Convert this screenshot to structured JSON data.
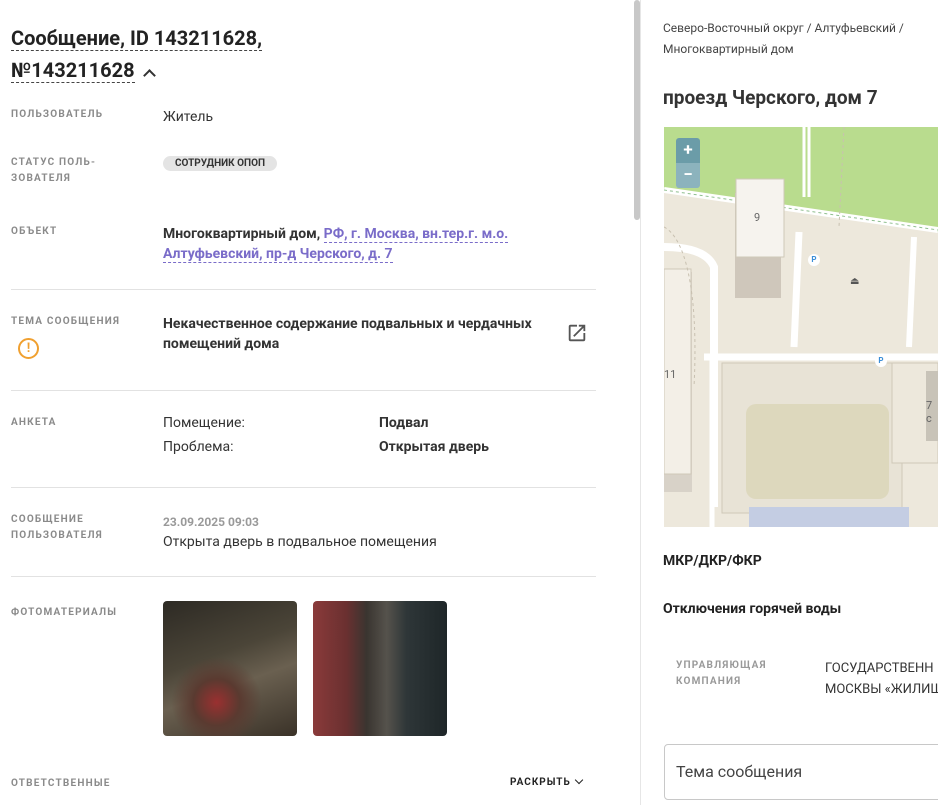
{
  "message": {
    "title_line1": "Сообщение, ID 143211628,",
    "title_line2": "№143211628"
  },
  "fields": {
    "user_label": "ПОЛЬЗОВАТЕЛЬ",
    "user_value": "Житель",
    "status_label_1": "СТАТУС ПОЛЬ-",
    "status_label_2": "ЗОВАТЕЛЯ",
    "status_badge": "СОТРУДНИК ОПОП",
    "object_label": "ОБЪЕКТ",
    "object_type": "Многоквартирный дом,",
    "object_addr_1": "РФ, г. Москва, вн.тер.г. м.о.",
    "object_addr_2": "Алтуфьевский, пр-д Черского, д. 7",
    "topic_label": "ТЕМА СООБЩЕНИЯ",
    "topic_1": "Некачественное содержание подвальных и чердачных",
    "topic_2": "помещений дома",
    "form_label": "АНКЕТА",
    "q1": "Помещение:",
    "a1": "Подвал",
    "q2": "Проблема:",
    "a2": "Открытая дверь",
    "msg_label_1": "СООБЩЕНИЕ",
    "msg_label_2": "ПОЛЬЗОВАТЕЛЯ",
    "msg_date": "23.09.2025 09:03",
    "msg_text": "Открыта дверь в подвальное помещения",
    "photos_label": "ФОТОМАТЕРИАЛЫ",
    "resp_label": "ОТВЕТСТВЕННЫЕ",
    "expand": "РАСКРЫТЬ"
  },
  "right": {
    "crumb_1": "Северо-Восточный округ / Алтуфьевский /",
    "crumb_2": "Многоквартирный дом",
    "address": "проезд Черского, дом 7",
    "map": {
      "zoom_in": "+",
      "zoom_out": "−",
      "house_9": "9",
      "house_11": "11",
      "house_7": "7 с",
      "parking": "P"
    },
    "sub1": "МКР/ДКР/ФКР",
    "sub2": "Отключения горячей воды",
    "mc_label_1": "УПРАВЛЯЮЩАЯ",
    "mc_label_2": "КОМПАНИЯ",
    "mc_val_1": "ГОСУДАРСТВЕНН",
    "mc_val_2": "МОСКВЫ «ЖИЛИЩ",
    "input_placeholder": "Тема сообщения"
  },
  "colors": {
    "link": "#7a6cc9",
    "warn": "#f0a030",
    "badge_bg": "#e4e4e4"
  }
}
